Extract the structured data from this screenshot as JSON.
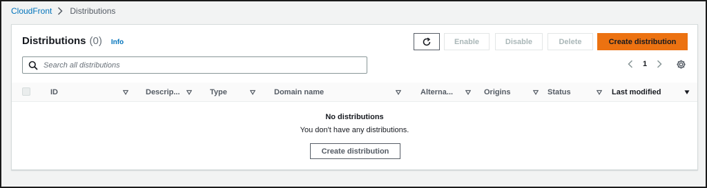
{
  "breadcrumb": {
    "root": "CloudFront",
    "current": "Distributions"
  },
  "panel": {
    "title": "Distributions",
    "count": "(0)",
    "info": "Info"
  },
  "toolbar": {
    "refresh_icon": "refresh-icon",
    "enable": "Enable",
    "disable": "Disable",
    "delete": "Delete",
    "create": "Create distribution"
  },
  "search": {
    "placeholder": "Search all distributions",
    "value": ""
  },
  "pagination": {
    "current_page": "1"
  },
  "table": {
    "columns": [
      "ID",
      "Descrip...",
      "Type",
      "Domain name",
      "Alterna...",
      "Origins",
      "Status",
      "Last modified"
    ],
    "sorted_column": "Last modified",
    "rows": []
  },
  "empty_state": {
    "title": "No distributions",
    "description": "You don't have any distributions.",
    "button": "Create distribution"
  },
  "colors": {
    "accent": "#ec7211",
    "link": "#0073bb",
    "page_bg": "#f2f3f3"
  }
}
